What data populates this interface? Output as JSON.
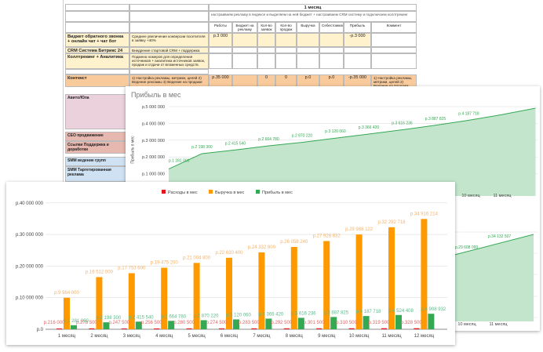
{
  "sheet": {
    "month_header": "1 месяц",
    "plan_text": "настраиваем рекламу в яндексе и выделяем на ней бюджет + настраиваем CRM систему и подключаем коллтрекинг",
    "columns": [
      "Работы",
      "Бюджет на рекламу",
      "Кол-во заявок",
      "Кол-во продаж",
      "Выручка",
      "Себестоимость",
      "Прибыль",
      "Коммент"
    ],
    "rows": [
      {
        "name": "Виджет обратного звонка + онлайн чат + чат бот",
        "desc": "Среднее увеличение конверсии посетителя в заявку +40%",
        "cells": [
          "р.3 000",
          "",
          "",
          "",
          "",
          "",
          "-р.3 000",
          ""
        ]
      },
      {
        "name": "CRM Система Битрикс 24",
        "desc": "Внедрение стартовой CRM + поддержка",
        "cells": [
          "",
          "",
          "",
          "",
          "",
          "",
          "",
          ""
        ]
      },
      {
        "name": "Коллтрекинг + Аналитика",
        "desc": "Подмена номеров для определения источников + аналитика источников заявок, продаж и отдачи от вложенных средств.",
        "cells": [
          "",
          "",
          "",
          "",
          "",
          "",
          "",
          ""
        ]
      },
      {
        "name": "Контекст",
        "desc": "1) Настройка рекламы, метрики, целей 2) Ведение рекламы 3) Ведение на продажи",
        "cells": [
          "р.35 000",
          "",
          "0",
          "0",
          "р.0",
          "р.0",
          "-р.35 000",
          "1) Настройка рекламы, метрики, целей 2) Ведение на продажи"
        ]
      }
    ],
    "left_items": [
      "Авито/Юла",
      "СЕО продвижение",
      "Ссылки Поддержка и доработки",
      "SMM ведение групп",
      "SMM Таргетированная реклама"
    ]
  },
  "area_chart": {
    "title": "Прибыль в мес",
    "ylabel": "Прибыль в мес",
    "yticks": [
      "р.5 000 000",
      "р.4 000 000",
      "р.3 000 000",
      "р.2 000 000",
      "р.1 000 000"
    ],
    "visible_xticks": [
      "10 месяц",
      "11 месяц"
    ],
    "color": "#34a853"
  },
  "area_chart2": {
    "labels": [
      "р.29 608 099",
      "р.34 132 507"
    ],
    "xticks": [
      "10 месяц",
      "11 месяц"
    ]
  },
  "chart_data": {
    "type": "bar",
    "categories": [
      "1 месяц",
      "2 месяц",
      "3 месяц",
      "4 месяц",
      "5 месяц",
      "6 месяц",
      "7 месяц",
      "8 месяц",
      "9 месяц",
      "10 месяц",
      "11 месяц",
      "12 месяц"
    ],
    "ylim": [
      0,
      40000000
    ],
    "yticks": [
      "р.0",
      "р.10 000 000",
      "р.20 000 000",
      "р.30 000 000",
      "р.40 000 000"
    ],
    "legend": "top",
    "series": [
      {
        "name": "Расходы в мес",
        "color": "#e8141b",
        "values": [
          216000,
          278500,
          247500,
          256500,
          280500,
          274500,
          283500,
          292500,
          301500,
          310500,
          319500,
          328500
        ],
        "labels": [
          "р.216 000",
          "р.278 500",
          "р.247 500",
          "р.256 500",
          "р.280 500",
          "р.274 500",
          "р.283 500",
          "р.292 500",
          "р.301 500",
          "р.310 500",
          "р.319 500",
          "р.328 500"
        ]
      },
      {
        "name": "Выручка в мес",
        "color": "#ff9900",
        "values": [
          9984000,
          16512000,
          17753600,
          19475200,
          21004800,
          22630400,
          24332800,
          26058240,
          27928832,
          29988122,
          32292718,
          34916214
        ],
        "labels": [
          "р.9 984 000",
          "р.16 512 000",
          "р.17 753 600",
          "р.19 475 200",
          "р.21 004 800",
          "р.22 630 400",
          "р.24 332 800",
          "р.26 058 240",
          "р.27 928 832",
          "р.29 988 122",
          "р.32 292 718",
          "р.34 916 214"
        ]
      },
      {
        "name": "Прибыль в мес",
        "color": "#34a853",
        "values": [
          1281000,
          2198300,
          2415540,
          2664780,
          2870220,
          3120060,
          3366420,
          3616236,
          3887825,
          4187718,
          4524408,
          4908932
        ],
        "labels": [
          "р.1 281 000",
          "р.2 198 300",
          "р.2 415 540",
          "р.2 664 780",
          "р.2 870 220",
          "р.3 120 060",
          "р.3 366 420",
          "р.3 616 236",
          "р.3 887 825",
          "р.4 187 718",
          "р.4 524 408",
          "р.4 908 932"
        ]
      }
    ]
  }
}
